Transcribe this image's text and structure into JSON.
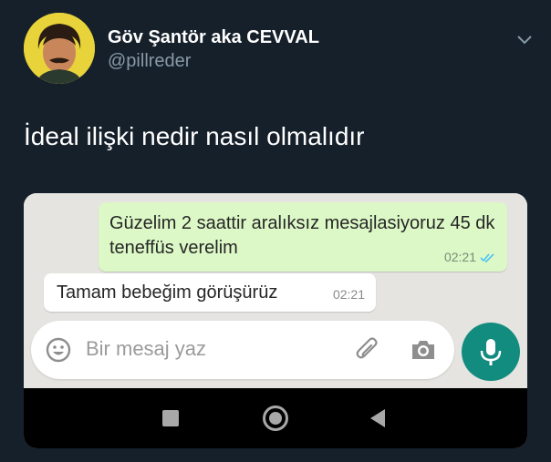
{
  "tweet": {
    "display_name": "Göv Şantör aka CEVVAL",
    "handle": "@pillreder",
    "text": "İdeal ilişki nedir nasıl olmalıdır"
  },
  "chat": {
    "outgoing": {
      "text": "Güzelim 2 saattir aralıksız mesajlasiyoruz 45 dk teneffüs verelim",
      "time": "02:21",
      "status_icon": "double-check-icon"
    },
    "incoming": {
      "text": "Tamam bebeğim görüşürüz",
      "time": "02:21"
    }
  },
  "composer": {
    "placeholder": "Bir mesaj yaz",
    "icons": [
      "emoji-icon",
      "attach-icon",
      "camera-icon",
      "mic-icon"
    ]
  },
  "colors": {
    "background": "#15202b",
    "outgoing_bubble": "#dcf8c6",
    "mic_button": "#128c7e",
    "read_ticks": "#4fc3f7"
  }
}
